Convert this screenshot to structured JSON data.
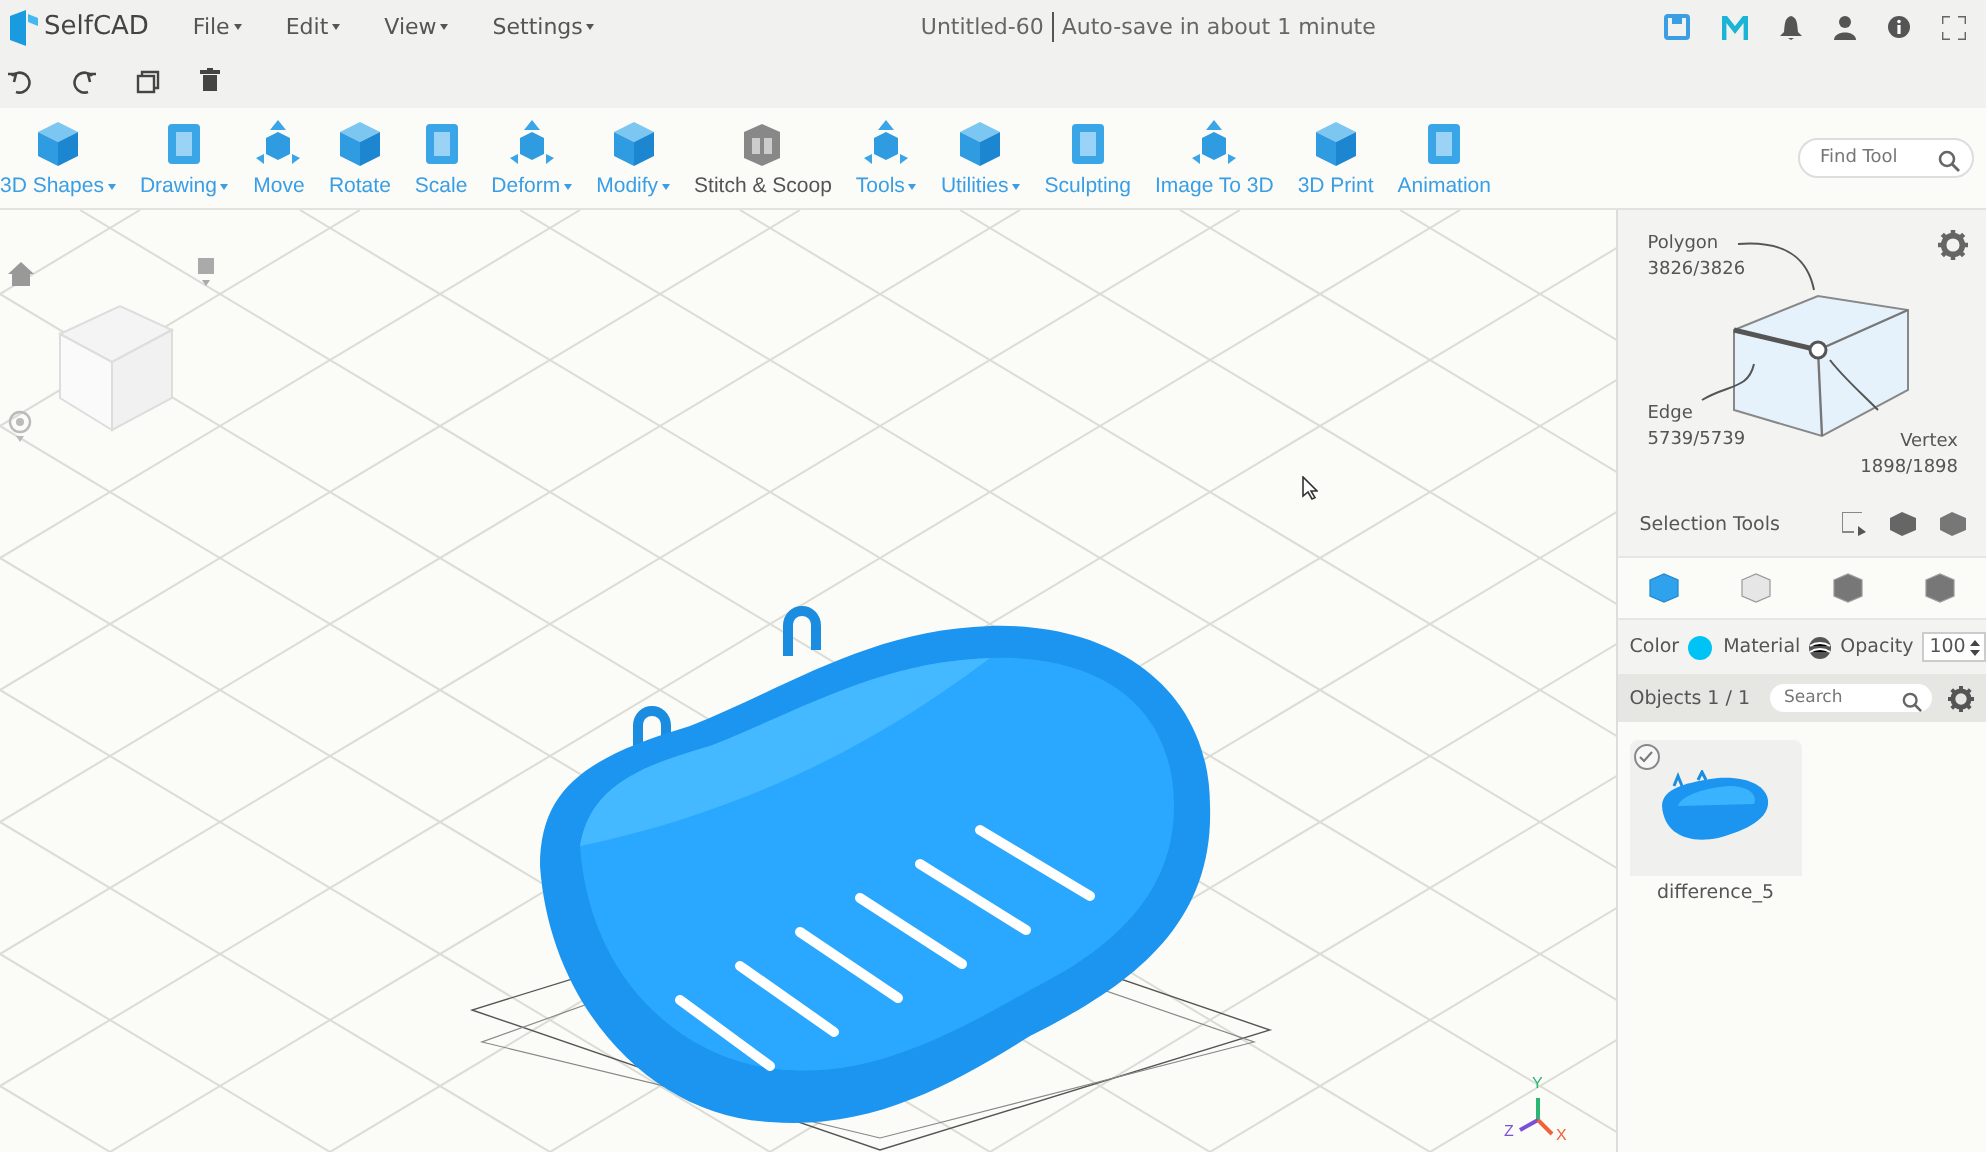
{
  "app": {
    "name": "SelfCAD"
  },
  "menus": [
    {
      "label": "File"
    },
    {
      "label": "Edit"
    },
    {
      "label": "View"
    },
    {
      "label": "Settings"
    }
  ],
  "document": {
    "title": "Untitled-60",
    "autosave": "Auto-save in about 1 minute"
  },
  "tools": [
    {
      "label": "3D Shapes",
      "kind": "dropdown"
    },
    {
      "label": "Drawing",
      "kind": "dropdown"
    },
    {
      "label": "Move",
      "kind": "button"
    },
    {
      "label": "Rotate",
      "kind": "button"
    },
    {
      "label": "Scale",
      "kind": "button"
    },
    {
      "label": "Deform",
      "kind": "dropdown"
    },
    {
      "label": "Modify",
      "kind": "dropdown"
    },
    {
      "label": "Stitch & Scoop",
      "kind": "feature"
    },
    {
      "label": "Tools",
      "kind": "dropdown"
    },
    {
      "label": "Utilities",
      "kind": "dropdown"
    },
    {
      "label": "Sculpting",
      "kind": "button"
    },
    {
      "label": "Image To 3D",
      "kind": "button"
    },
    {
      "label": "3D Print",
      "kind": "button"
    },
    {
      "label": "Animation",
      "kind": "button"
    }
  ],
  "find_tool": {
    "placeholder": "Find Tool"
  },
  "selection_panel": {
    "polygon": {
      "label": "Polygon",
      "count": "3826/3826"
    },
    "edge": {
      "label": "Edge",
      "count": "5739/5739"
    },
    "vertex": {
      "label": "Vertex",
      "count": "1898/1898"
    },
    "tools_label": "Selection Tools",
    "modes": [
      {
        "selected": true
      },
      {
        "selected": false
      },
      {
        "selected": false
      },
      {
        "selected": false
      }
    ]
  },
  "appearance": {
    "color_label": "Color",
    "color": "#00c3f5",
    "material_label": "Material",
    "opacity_label": "Opacity",
    "opacity": "100"
  },
  "objects": {
    "title": "Objects 1 / 1",
    "search_placeholder": "Search",
    "items": [
      {
        "name": "difference_5",
        "checked": true
      }
    ]
  },
  "axes": [
    {
      "label": "Y"
    },
    {
      "label": "Z"
    },
    {
      "label": "X"
    }
  ]
}
